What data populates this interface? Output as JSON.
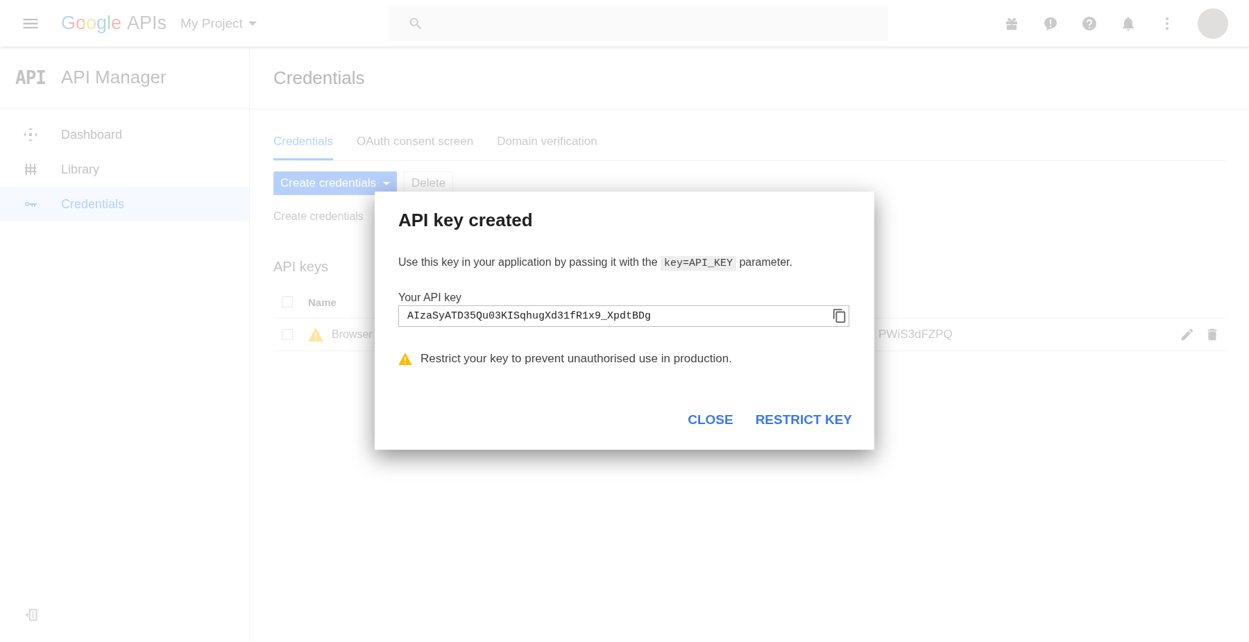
{
  "top_bar": {
    "logo": "Google",
    "product": "APIs",
    "project": "My Project"
  },
  "sidebar": {
    "badge": "API",
    "title": "API Manager",
    "items": [
      {
        "label": "Dashboard",
        "selected": false
      },
      {
        "label": "Library",
        "selected": false
      },
      {
        "label": "Credentials",
        "selected": true
      }
    ]
  },
  "page": {
    "title": "Credentials",
    "tabs": [
      {
        "label": "Credentials",
        "selected": true
      },
      {
        "label": "OAuth consent screen",
        "selected": false
      },
      {
        "label": "Domain verification",
        "selected": false
      }
    ],
    "buttons": [
      {
        "label": "Create credentials",
        "kind": "primary",
        "disabled": false
      },
      {
        "label": "Delete",
        "kind": "plain",
        "disabled": true
      }
    ],
    "hint": "Create credentials",
    "section": "API keys",
    "table": {
      "header": {
        "label": "Name",
        "checked": false
      },
      "rows": [
        {
          "name": "Browser",
          "key": "PWiS3dFZPQ",
          "checked": false
        }
      ]
    }
  },
  "dialog": {
    "title": "API key created",
    "message": {
      "before": "Use this key in your application by passing it with the",
      "code": "key=API_KEY",
      "after": "parameter."
    },
    "field_label": "Your API key",
    "api_key": "AIzaSyATD35Qu03KISqhugXd31fR1x9_XpdtBDg",
    "warning": "Restrict your key to prevent unauthorised use in production.",
    "actions": [
      "CLOSE",
      "RESTRICT KEY"
    ]
  }
}
